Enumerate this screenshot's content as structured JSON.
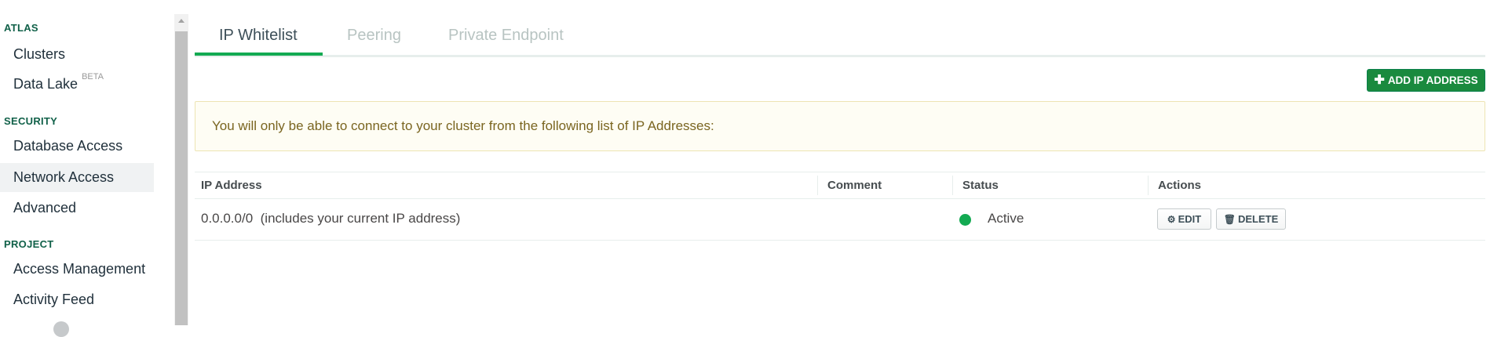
{
  "sidebar": {
    "sections": [
      {
        "title": "ATLAS",
        "items": [
          {
            "label": "Clusters"
          },
          {
            "label": "Data Lake",
            "badge": "BETA"
          }
        ]
      },
      {
        "title": "SECURITY",
        "items": [
          {
            "label": "Database Access"
          },
          {
            "label": "Network Access",
            "active": true
          },
          {
            "label": "Advanced"
          }
        ]
      },
      {
        "title": "PROJECT",
        "items": [
          {
            "label": "Access Management"
          },
          {
            "label": "Activity Feed"
          }
        ]
      }
    ]
  },
  "tabs": [
    {
      "label": "IP Whitelist",
      "active": true
    },
    {
      "label": "Peering"
    },
    {
      "label": "Private Endpoint"
    }
  ],
  "toolbar": {
    "add_label": "ADD IP ADDRESS",
    "add_icon": "plus-icon"
  },
  "banner": {
    "text": "You will only be able to connect to your cluster from the following list of IP Addresses:"
  },
  "table": {
    "columns": [
      "IP Address",
      "Comment",
      "Status",
      "Actions"
    ],
    "rows": [
      {
        "ip": "0.0.0.0/0",
        "note": "(includes your current IP address)",
        "comment": "",
        "status": "Active",
        "status_color": "#13aa52",
        "edit_label": "EDIT",
        "delete_label": "DELETE"
      }
    ]
  },
  "colors": {
    "accent": "#13aa52",
    "section_title": "#116149",
    "button": "#1a8a3e"
  }
}
